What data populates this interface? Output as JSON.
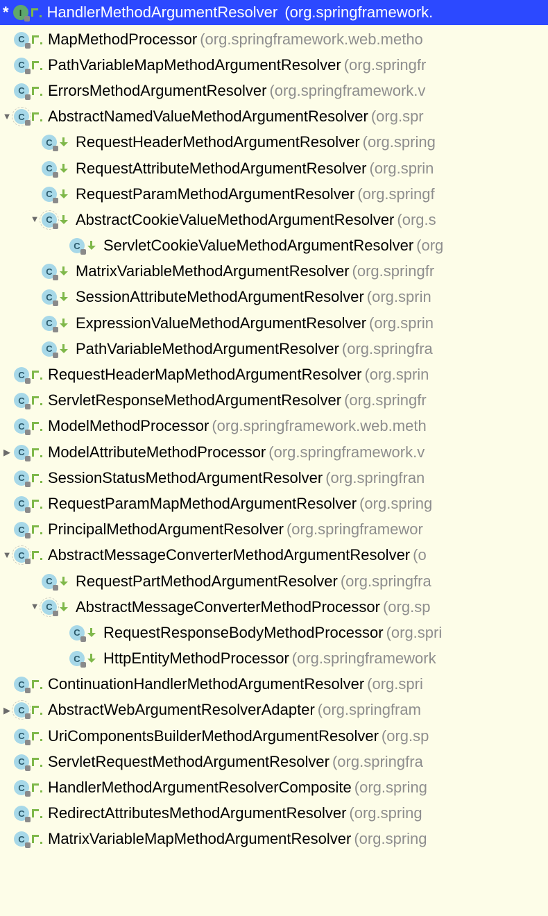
{
  "header": {
    "asterisk": "*",
    "title": "HandlerMethodArgumentResolver",
    "package": "(org.springframework."
  },
  "rows": [
    {
      "indent": 1,
      "arrow": "",
      "iconType": "c",
      "abstract": false,
      "relIcon": "impl",
      "name": "MapMethodProcessor",
      "package": "(org.springframework.web.metho"
    },
    {
      "indent": 1,
      "arrow": "",
      "iconType": "c",
      "abstract": false,
      "relIcon": "impl",
      "name": "PathVariableMapMethodArgumentResolver",
      "package": "(org.springfr"
    },
    {
      "indent": 1,
      "arrow": "",
      "iconType": "c",
      "abstract": false,
      "relIcon": "impl",
      "name": "ErrorsMethodArgumentResolver",
      "package": "(org.springframework.v"
    },
    {
      "indent": 1,
      "arrow": "down",
      "iconType": "c",
      "abstract": true,
      "relIcon": "impl",
      "name": "AbstractNamedValueMethodArgumentResolver",
      "package": "(org.spr"
    },
    {
      "indent": 2,
      "arrow": "",
      "iconType": "c",
      "abstract": false,
      "relIcon": "down",
      "name": "RequestHeaderMethodArgumentResolver",
      "package": "(org.spring"
    },
    {
      "indent": 2,
      "arrow": "",
      "iconType": "c",
      "abstract": false,
      "relIcon": "down",
      "name": "RequestAttributeMethodArgumentResolver",
      "package": "(org.sprin"
    },
    {
      "indent": 2,
      "arrow": "",
      "iconType": "c",
      "abstract": false,
      "relIcon": "down",
      "name": "RequestParamMethodArgumentResolver",
      "package": "(org.springf"
    },
    {
      "indent": 2,
      "arrow": "down",
      "iconType": "c",
      "abstract": true,
      "relIcon": "down",
      "name": "AbstractCookieValueMethodArgumentResolver",
      "package": "(org.s"
    },
    {
      "indent": 3,
      "arrow": "",
      "iconType": "c",
      "abstract": false,
      "relIcon": "down",
      "name": "ServletCookieValueMethodArgumentResolver",
      "package": "(org"
    },
    {
      "indent": 2,
      "arrow": "",
      "iconType": "c",
      "abstract": false,
      "relIcon": "down",
      "name": "MatrixVariableMethodArgumentResolver",
      "package": "(org.springfr"
    },
    {
      "indent": 2,
      "arrow": "",
      "iconType": "c",
      "abstract": false,
      "relIcon": "down",
      "name": "SessionAttributeMethodArgumentResolver",
      "package": "(org.sprin"
    },
    {
      "indent": 2,
      "arrow": "",
      "iconType": "c",
      "abstract": false,
      "relIcon": "down",
      "name": "ExpressionValueMethodArgumentResolver",
      "package": "(org.sprin"
    },
    {
      "indent": 2,
      "arrow": "",
      "iconType": "c",
      "abstract": false,
      "relIcon": "down",
      "name": "PathVariableMethodArgumentResolver",
      "package": "(org.springfra"
    },
    {
      "indent": 1,
      "arrow": "",
      "iconType": "c",
      "abstract": false,
      "relIcon": "impl",
      "name": "RequestHeaderMapMethodArgumentResolver",
      "package": "(org.sprin"
    },
    {
      "indent": 1,
      "arrow": "",
      "iconType": "c",
      "abstract": false,
      "relIcon": "impl",
      "name": "ServletResponseMethodArgumentResolver",
      "package": "(org.springfr"
    },
    {
      "indent": 1,
      "arrow": "",
      "iconType": "c",
      "abstract": false,
      "relIcon": "impl",
      "name": "ModelMethodProcessor",
      "package": "(org.springframework.web.meth"
    },
    {
      "indent": 1,
      "arrow": "right",
      "iconType": "c",
      "abstract": false,
      "relIcon": "impl",
      "name": "ModelAttributeMethodProcessor",
      "package": "(org.springframework.v"
    },
    {
      "indent": 1,
      "arrow": "",
      "iconType": "c",
      "abstract": false,
      "relIcon": "impl",
      "name": "SessionStatusMethodArgumentResolver",
      "package": "(org.springfran"
    },
    {
      "indent": 1,
      "arrow": "",
      "iconType": "c",
      "abstract": false,
      "relIcon": "impl",
      "name": "RequestParamMapMethodArgumentResolver",
      "package": "(org.spring"
    },
    {
      "indent": 1,
      "arrow": "",
      "iconType": "c",
      "abstract": false,
      "relIcon": "impl",
      "name": "PrincipalMethodArgumentResolver",
      "package": "(org.springframewor"
    },
    {
      "indent": 1,
      "arrow": "down",
      "iconType": "c",
      "abstract": true,
      "relIcon": "impl",
      "name": "AbstractMessageConverterMethodArgumentResolver",
      "package": "(o"
    },
    {
      "indent": 2,
      "arrow": "",
      "iconType": "c",
      "abstract": false,
      "relIcon": "down",
      "name": "RequestPartMethodArgumentResolver",
      "package": "(org.springfra"
    },
    {
      "indent": 2,
      "arrow": "down",
      "iconType": "c",
      "abstract": true,
      "relIcon": "down",
      "name": "AbstractMessageConverterMethodProcessor",
      "package": "(org.sp"
    },
    {
      "indent": 3,
      "arrow": "",
      "iconType": "c",
      "abstract": false,
      "relIcon": "down",
      "name": "RequestResponseBodyMethodProcessor",
      "package": "(org.spri"
    },
    {
      "indent": 3,
      "arrow": "",
      "iconType": "c",
      "abstract": false,
      "relIcon": "down",
      "name": "HttpEntityMethodProcessor",
      "package": "(org.springframework"
    },
    {
      "indent": 1,
      "arrow": "",
      "iconType": "c",
      "abstract": false,
      "relIcon": "impl",
      "name": "ContinuationHandlerMethodArgumentResolver",
      "package": "(org.spri"
    },
    {
      "indent": 1,
      "arrow": "right",
      "iconType": "c",
      "abstract": true,
      "relIcon": "impl",
      "name": "AbstractWebArgumentResolverAdapter",
      "package": "(org.springfram"
    },
    {
      "indent": 1,
      "arrow": "",
      "iconType": "c",
      "abstract": false,
      "relIcon": "impl",
      "name": "UriComponentsBuilderMethodArgumentResolver",
      "package": "(org.sp"
    },
    {
      "indent": 1,
      "arrow": "",
      "iconType": "c",
      "abstract": false,
      "relIcon": "impl",
      "name": "ServletRequestMethodArgumentResolver",
      "package": "(org.springfra"
    },
    {
      "indent": 1,
      "arrow": "",
      "iconType": "c",
      "abstract": false,
      "relIcon": "impl",
      "name": "HandlerMethodArgumentResolverComposite",
      "package": "(org.spring"
    },
    {
      "indent": 1,
      "arrow": "",
      "iconType": "c",
      "abstract": false,
      "relIcon": "impl",
      "name": "RedirectAttributesMethodArgumentResolver",
      "package": "(org.spring"
    },
    {
      "indent": 1,
      "arrow": "",
      "iconType": "c",
      "abstract": false,
      "relIcon": "impl",
      "name": "MatrixVariableMapMethodArgumentResolver",
      "package": "(org.spring"
    }
  ]
}
